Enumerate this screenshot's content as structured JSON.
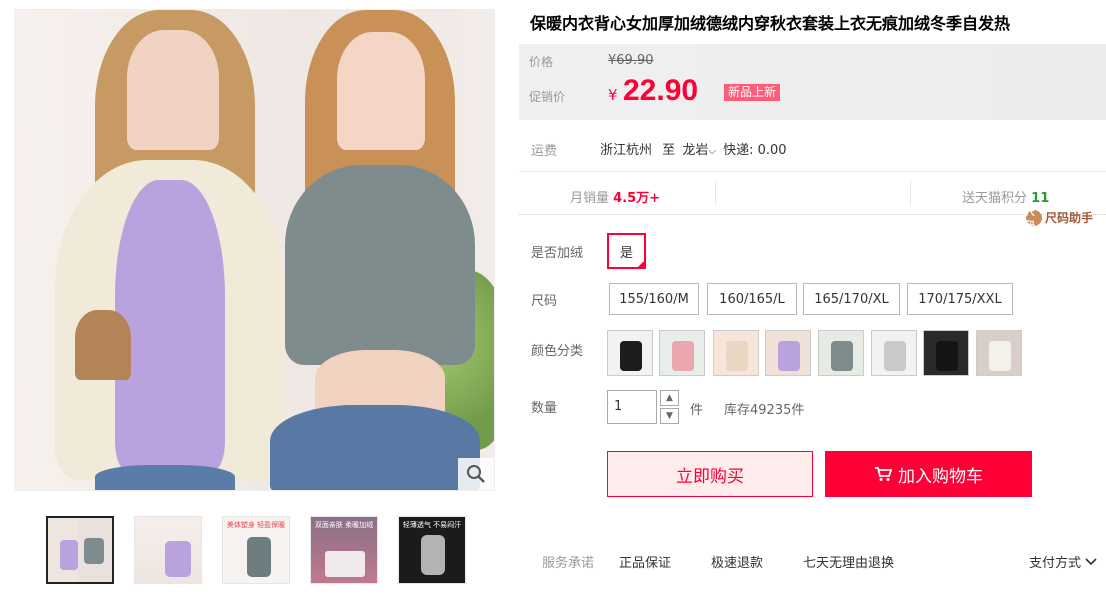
{
  "product": {
    "title": "保暖内衣背心女加厚加绒德绒内穿秋衣套装上衣无痕加绒冬季自发热"
  },
  "price": {
    "price_label": "价格",
    "original": "69.90",
    "original_symbol": "¥",
    "promo_label": "促销价",
    "promo_symbol": "¥",
    "promo": "22.90",
    "badge": "新品上新",
    "accent_color": "#ff0036"
  },
  "shipping": {
    "label": "运费",
    "origin": "浙江杭州",
    "to": "至",
    "destination": "龙岩",
    "method": "快递:",
    "fee": "0.00"
  },
  "stats": {
    "monthly_sales_label": "月销量",
    "monthly_sales_value": "4.5万+",
    "points_label": "送天猫积分",
    "points_value": "11"
  },
  "size_helper": {
    "icon_text": "尺码",
    "label": "尺码助手"
  },
  "options": {
    "fleece": {
      "label": "是否加绒",
      "values": [
        "是"
      ],
      "selected": "是"
    },
    "size": {
      "label": "尺码",
      "values": [
        "155/160/M",
        "160/165/L",
        "165/170/XL",
        "170/175/XXL"
      ]
    },
    "color": {
      "label": "颜色分类",
      "swatches": [
        {
          "icon": "black-vest",
          "color": "#1c1c1c",
          "bg": "#f2f2f2"
        },
        {
          "icon": "pink-vest",
          "color": "#e9a7ad",
          "bg": "#e7ede8"
        },
        {
          "icon": "beige-vest",
          "color": "#ead6c2",
          "bg": "#f7e5d9"
        },
        {
          "icon": "purple-vest",
          "color": "#b9a2dd",
          "bg": "#efe0d8"
        },
        {
          "icon": "gray-vest",
          "color": "#7f8c8e",
          "bg": "#e6ece4"
        },
        {
          "icon": "light-gray-vest",
          "color": "#c9c9c9",
          "bg": "#f2f2f2"
        },
        {
          "icon": "black-vest-2",
          "color": "#141414",
          "bg": "#2a2a2a"
        },
        {
          "icon": "white-vest",
          "color": "#f4f1ea",
          "bg": "#d8d0c7"
        }
      ]
    }
  },
  "quantity": {
    "label": "数量",
    "value": "1",
    "unit": "件",
    "stock": "库存49235件"
  },
  "actions": {
    "buy_now": "立即购买",
    "add_to_cart": "加入购物车"
  },
  "service": {
    "label": "服务承诺",
    "items": [
      "正品保证",
      "极速退款",
      "七天无理由退换"
    ],
    "payment": "支付方式"
  },
  "gallery": {
    "thumb_captions": [
      "",
      "",
      "美体塑身 轻盈保暖",
      "双面亲肤 柔暖加绒",
      "轻薄透气 不易闷汗"
    ]
  }
}
